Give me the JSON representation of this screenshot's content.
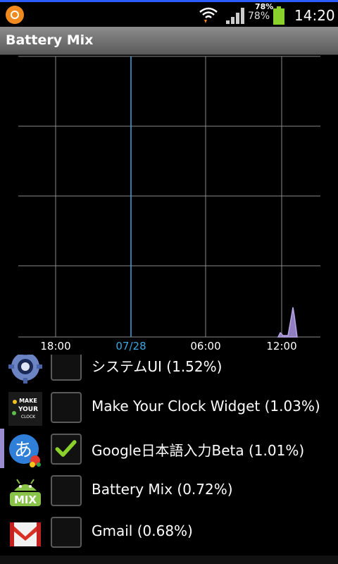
{
  "status_bar": {
    "battery_percent_top": "78%",
    "battery_percent": "78%",
    "time": "14:20",
    "icons": [
      "app-notification-icon",
      "wifi-icon",
      "signal-icon",
      "battery-icon"
    ]
  },
  "app": {
    "title": "Battery Mix"
  },
  "chart": {
    "x_ticks": [
      "18:00",
      "07/28",
      "06:00",
      "12:00"
    ],
    "highlight_tick": "07/28",
    "colors": {
      "grid": "#8a8a8a",
      "highlight": "#3aa7e0",
      "series": "#b9a6e6"
    }
  },
  "chart_data": {
    "type": "area",
    "x_tick_labels": [
      "18:00",
      "07/28",
      "06:00",
      "12:00"
    ],
    "series": [
      {
        "values": [
          0,
          0,
          0,
          0,
          0,
          0,
          0.1,
          0,
          0.9,
          0,
          0
        ]
      }
    ],
    "grid": true
  },
  "apps": [
    {
      "icon": "gear-icon",
      "label": "システムUI (1.52%)",
      "checked": false
    },
    {
      "icon": "make-your-clock-icon",
      "label": "Make Your Clock Widget (1.03%)",
      "checked": false
    },
    {
      "icon": "google-japanese-input-icon",
      "label": "Google日本語入力Beta (1.01%)",
      "checked": true
    },
    {
      "icon": "android-mix-icon",
      "label": "Battery Mix (0.72%)",
      "checked": false
    },
    {
      "icon": "gmail-icon",
      "label": "Gmail (0.68%)",
      "checked": false
    }
  ],
  "icon_text": {
    "make_your_clock": [
      "MAKE",
      "YOUR",
      "CLOCK"
    ],
    "google_input": "あ",
    "android_mix": "MIX"
  }
}
